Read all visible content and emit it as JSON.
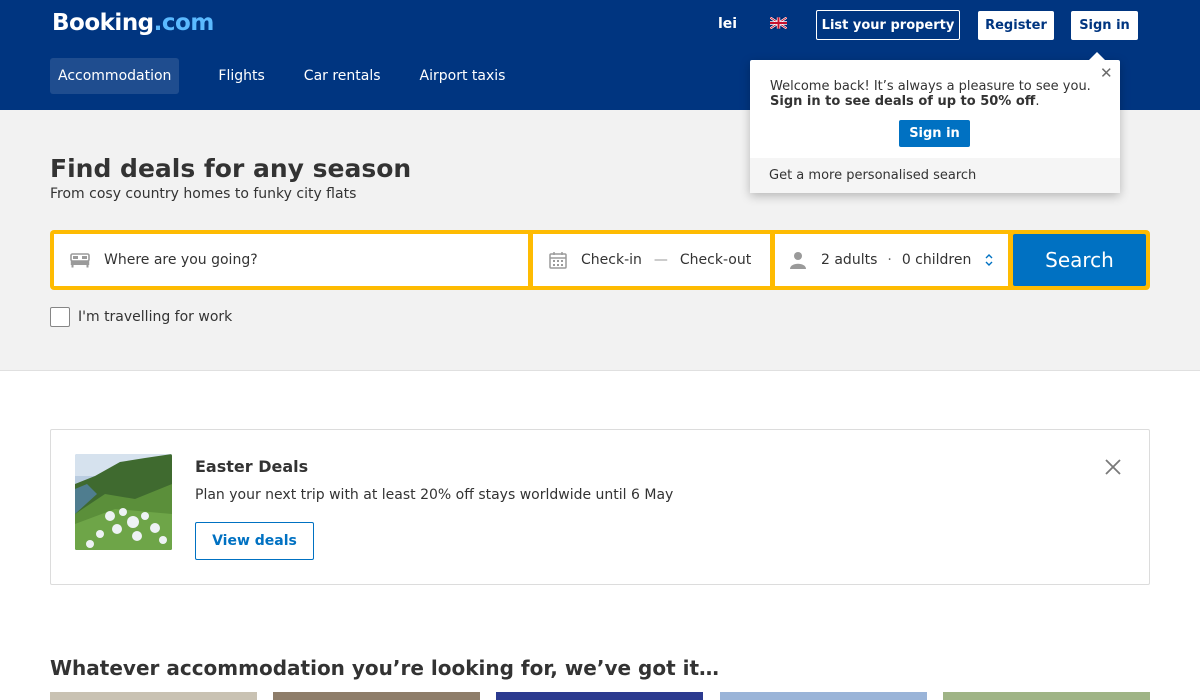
{
  "header": {
    "logo_text": "Booking",
    "logo_suffix": ".com",
    "currency": "lei",
    "language_flag": "uk-flag-icon",
    "list_property_label": "List your property",
    "register_label": "Register",
    "sign_in_label": "Sign in"
  },
  "nav": {
    "items": [
      {
        "label": "Accommodation",
        "active": true
      },
      {
        "label": "Flights",
        "active": false
      },
      {
        "label": "Car rentals",
        "active": false
      },
      {
        "label": "Airport taxis",
        "active": false
      }
    ]
  },
  "hero": {
    "title": "Find deals for any season",
    "subtitle": "From cosy country homes to funky city flats"
  },
  "search": {
    "destination_placeholder": "Where are you going?",
    "checkin_label": "Check-in",
    "checkout_label": "Check-out",
    "adults": "2 adults",
    "children": "0 children",
    "search_label": "Search",
    "work_travel_label": "I'm travelling for work"
  },
  "popup": {
    "line1": "Welcome back! It’s always a pleasure to see you.",
    "line2_bold": "Sign in to see deals of up to 50% off",
    "line2_end": ".",
    "sign_in_label": "Sign in",
    "footer": "Get a more personalised search"
  },
  "deals": {
    "title": "Easter Deals",
    "text": "Plan your next trip with at least 20% off stays worldwide until 6 May",
    "button_label": "View deals"
  },
  "accommodation": {
    "title": "Whatever accommodation you’re looking for, we’ve got it…"
  },
  "colors": {
    "brand_blue": "#003580",
    "action_blue": "#0071c2",
    "search_yellow": "#febb02"
  }
}
